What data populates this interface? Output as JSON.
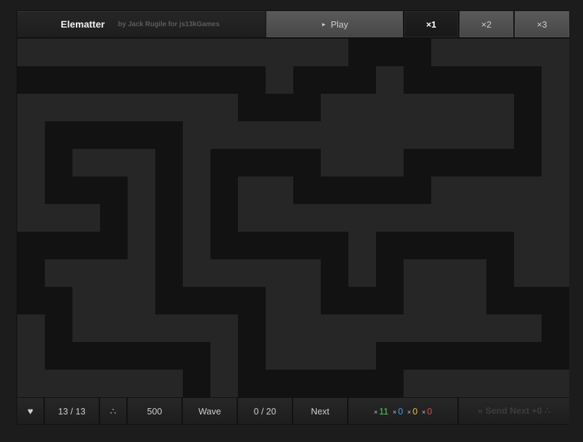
{
  "header": {
    "title": "Elematter",
    "byline": "by Jack Rugile for js13kGames",
    "play_label": "Play",
    "play_icon": "play-triangle-icon",
    "speeds": [
      {
        "label": "×1",
        "active": true
      },
      {
        "label": "×2",
        "active": false
      },
      {
        "label": "×3",
        "active": false
      }
    ]
  },
  "status": {
    "lives_icon": "heart-icon",
    "lives": "13 / 13",
    "currency_icon": "triangle-dots-icon",
    "currency": "500",
    "wave_label": "Wave",
    "wave": "0 / 20",
    "next_label": "Next",
    "resources": [
      {
        "prefix": "×",
        "value": "11",
        "color": "#55cc55"
      },
      {
        "prefix": "×",
        "value": "0",
        "color": "#3fa4e0"
      },
      {
        "prefix": "×",
        "value": "0",
        "color": "#e8c33a"
      },
      {
        "prefix": "×",
        "value": "0",
        "color": "#e04a4a"
      }
    ],
    "send_next": "» Send Next +0 ∴"
  },
  "colors": {
    "maze_floor": "#262626",
    "maze_wall": "#121212",
    "button_face": "#4f4f4f"
  }
}
